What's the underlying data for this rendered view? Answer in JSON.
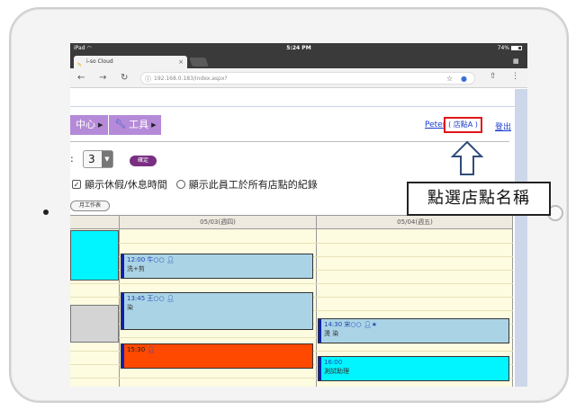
{
  "status": {
    "device": "iPad",
    "wifi": "wifi-icon",
    "time": "5:24 PM",
    "battery": "74%"
  },
  "browser": {
    "tab_title": "i-so Cloud",
    "url": "192.168.0.183/index.aspx?"
  },
  "menu": [
    {
      "label": "中心"
    },
    {
      "label": "工具"
    }
  ],
  "header": {
    "user": "Peter",
    "store": "( 店點A )",
    "logout": "登出"
  },
  "filters": {
    "colon": ":",
    "select_value": "3",
    "confirm": "確定",
    "show_leave": "顯示休假/休息時間",
    "show_all_stores": "顯示此員工於所有店點的紀錄",
    "month_btn": "月工作表"
  },
  "calendar": {
    "days": [
      {
        "label": "05/03(週四)"
      },
      {
        "label": "05/04(週五)"
      }
    ],
    "events": [
      {
        "time": "12:00 牛○○",
        "desc": "洗+剪"
      },
      {
        "time": "13:45 王○○",
        "desc": "染"
      },
      {
        "time": "15:30",
        "desc": ""
      },
      {
        "time": "14:30 宋○○",
        "desc": "燙 染"
      },
      {
        "time": "16:00",
        "desc": "測試助理"
      }
    ],
    "colors": {
      "light_blue": "#aad4e6",
      "cyan": "#00f5ff",
      "orange": "#ff4800",
      "gray": "#d4d4d4",
      "yellow": "#fdfbe0"
    }
  },
  "callout": {
    "text": "點選店點名稱"
  }
}
